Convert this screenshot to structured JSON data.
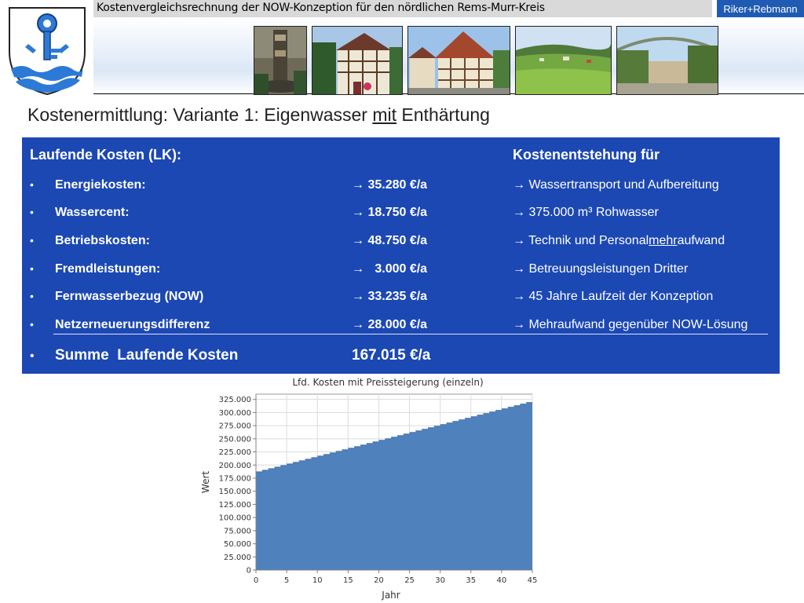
{
  "header": {
    "title": "Kostenvergleichsrechnung der NOW-Konzeption für den nördlichen Rems-Murr-Kreis",
    "brand": "Riker+Rebmann"
  },
  "page": {
    "title_before": "Kostenermittlung: Variante 1: Eigenwasser ",
    "title_emph": "mit",
    "title_after": " Enthärtung"
  },
  "panel": {
    "lk_heading": "Laufende Kosten (LK):",
    "origin_heading": "Kostenentstehung für",
    "bullet": "•",
    "arrow": "→",
    "rows": [
      {
        "label": "Energiekosten:",
        "amount": "35.280 €/a",
        "origin": "Wassertransport und Aufbereitung"
      },
      {
        "label": "Wassercent:",
        "amount": "18.750 €/a",
        "origin": "375.000 m³ Rohwasser"
      },
      {
        "label": "Betriebskosten:",
        "amount": "48.750 €/a",
        "origin_before": "Technik und Personal",
        "origin_emph": "mehr",
        "origin_after": "aufwand"
      },
      {
        "label": "Fremdleistungen:",
        "amount": "  3.000 €/a",
        "origin": "Betreuungsleistungen Dritter"
      },
      {
        "label": "Fernwasserbezug (NOW)",
        "amount": "33.235 €/a",
        "origin": "45 Jahre Laufzeit der Konzeption"
      },
      {
        "label": "Netzerneuerungsdifferenz",
        "amount": "28.000 €/a",
        "origin": "Mehraufwand gegenüber NOW-Lösung"
      }
    ],
    "sum": {
      "label": "Summe  Laufende Kosten",
      "amount": "167.015 €/a"
    }
  },
  "chart_data": {
    "type": "area",
    "title": "Lfd. Kosten mit Preissteigerung (einzeln)",
    "xlabel": "Jahr",
    "ylabel": "Wert",
    "xlim": [
      0,
      45
    ],
    "ylim": [
      0,
      335000
    ],
    "x_ticks": [
      0,
      5,
      10,
      15,
      20,
      25,
      30,
      35,
      40,
      45
    ],
    "y_ticks": [
      0,
      25000,
      50000,
      75000,
      100000,
      125000,
      150000,
      175000,
      200000,
      225000,
      250000,
      275000,
      300000,
      325000
    ],
    "y_tick_labels": [
      "0",
      "25.000",
      "50.000",
      "75.000",
      "100.000",
      "125.000",
      "150.000",
      "175.000",
      "200.000",
      "225.000",
      "250.000",
      "275.000",
      "300.000",
      "325.000"
    ],
    "grid": true,
    "color": "#4f81bd",
    "series": [
      {
        "x": [
          1,
          2,
          3,
          4,
          5,
          6,
          7,
          8,
          9,
          10,
          11,
          12,
          13,
          14,
          15,
          16,
          17,
          18,
          19,
          20,
          21,
          22,
          23,
          24,
          25,
          26,
          27,
          28,
          29,
          30,
          31,
          32,
          33,
          34,
          35,
          36,
          37,
          38,
          39,
          40,
          41,
          42,
          43,
          44,
          45
        ],
        "values": [
          187000,
          190000,
          193000,
          196000,
          199000,
          202000,
          205000,
          208000,
          211000,
          214000,
          217000,
          220000,
          223000,
          226000,
          229000,
          232000,
          235000,
          238000,
          241000,
          244000,
          247000,
          250000,
          253000,
          256000,
          259000,
          262000,
          265000,
          268000,
          271000,
          274000,
          277000,
          280000,
          283000,
          286000,
          289000,
          292000,
          295000,
          298000,
          301000,
          304000,
          307000,
          310000,
          313000,
          316000,
          319000
        ]
      }
    ]
  }
}
